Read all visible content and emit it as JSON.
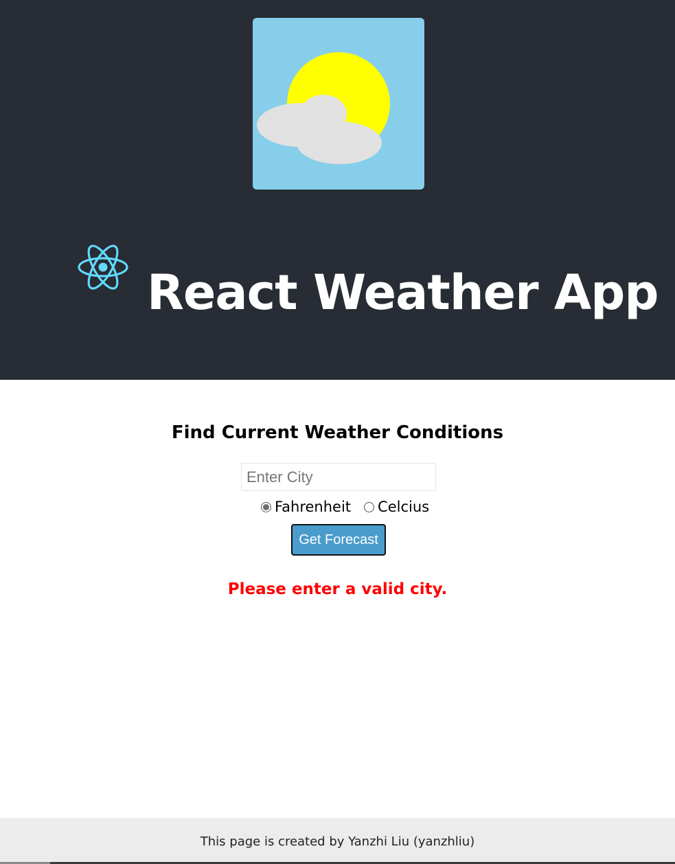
{
  "header": {
    "logo_icon": "sun-cloud-icon",
    "react_icon": "react-atom-icon",
    "title": "React Weather App",
    "background_color": "#282c34"
  },
  "form": {
    "heading": "Find Current Weather Conditions",
    "city_input": {
      "placeholder": "Enter City",
      "value": ""
    },
    "units": [
      {
        "label": "Fahrenheit",
        "checked": true
      },
      {
        "label": "Celcius",
        "checked": false
      }
    ],
    "submit_label": "Get Forecast",
    "button_color": "#4a9ccc"
  },
  "error": {
    "message": "Please enter a valid city.",
    "color": "#ff0000"
  },
  "footer": {
    "text": "This page is created by Yanzhi Liu (yanzhliu)"
  }
}
